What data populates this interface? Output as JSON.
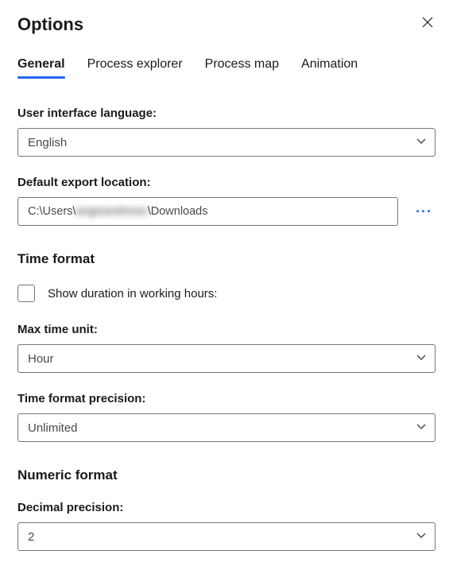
{
  "dialog": {
    "title": "Options"
  },
  "tabs": {
    "general": "General",
    "processExplorer": "Process explorer",
    "processMap": "Process map",
    "animation": "Animation"
  },
  "fields": {
    "uiLanguage": {
      "label": "User interface language:",
      "value": "English"
    },
    "exportLocation": {
      "label": "Default export location:",
      "prefix": "C:\\Users\\",
      "redacted": "angieandrews",
      "suffix": "\\Downloads"
    }
  },
  "sections": {
    "timeFormat": {
      "title": "Time format",
      "showDuration": {
        "label": "Show duration in working hours:",
        "checked": false
      },
      "maxTimeUnit": {
        "label": "Max time unit:",
        "value": "Hour"
      },
      "precision": {
        "label": "Time format precision:",
        "value": "Unlimited"
      }
    },
    "numericFormat": {
      "title": "Numeric format",
      "decimalPrecision": {
        "label": "Decimal precision:",
        "value": "2"
      }
    }
  }
}
